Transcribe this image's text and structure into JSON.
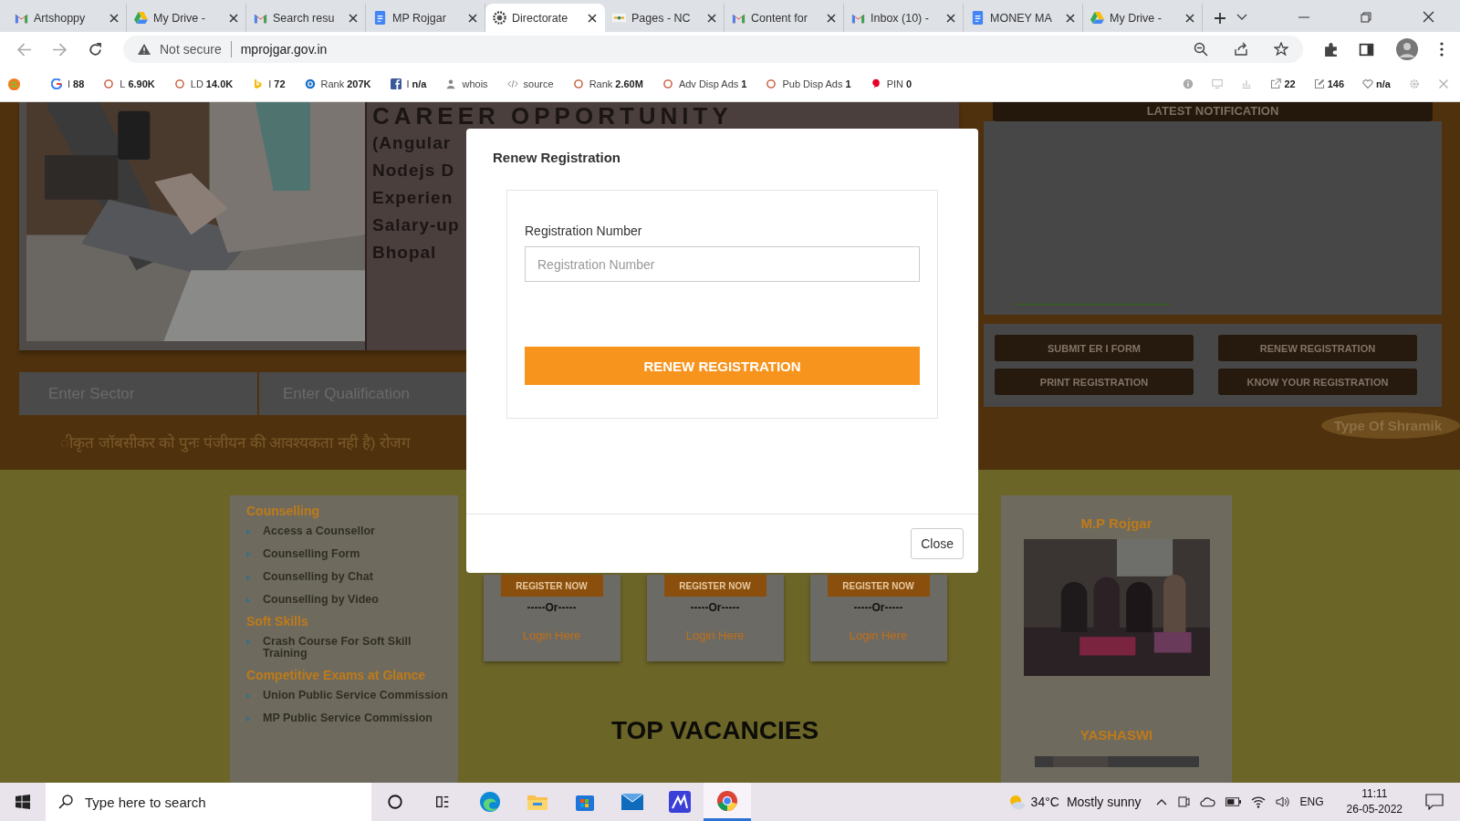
{
  "browser": {
    "tabs": [
      {
        "title": "Artshoppy",
        "selected": false
      },
      {
        "title": "My Drive -",
        "selected": false
      },
      {
        "title": "Search resu",
        "selected": false
      },
      {
        "title": "MP Rojgar",
        "selected": false
      },
      {
        "title": "Directorate",
        "selected": true
      },
      {
        "title": "Pages - NC",
        "selected": false
      },
      {
        "title": "Content for",
        "selected": false
      },
      {
        "title": "Inbox (10) -",
        "selected": false
      },
      {
        "title": "MONEY MA",
        "selected": false
      },
      {
        "title": "My Drive -",
        "selected": false
      }
    ],
    "security": "Not secure",
    "url": "mprojgar.gov.in",
    "seo_bar": [
      {
        "label": "I",
        "value": "88"
      },
      {
        "label": "L",
        "value": "6.90K"
      },
      {
        "label": "LD",
        "value": "14.0K"
      },
      {
        "label": "I",
        "value": "72"
      },
      {
        "label": "Rank",
        "value": "207K"
      },
      {
        "label": "I",
        "value": "n/a"
      },
      {
        "label": "whois"
      },
      {
        "label": "source"
      },
      {
        "label": "Rank",
        "value": "2.60M"
      },
      {
        "label": "Adv Disp Ads",
        "value": "1"
      },
      {
        "label": "Pub Disp Ads",
        "value": "1"
      },
      {
        "label": "PIN",
        "value": "0"
      }
    ],
    "seo_right": [
      {
        "value": "22"
      },
      {
        "value": "146"
      },
      {
        "value": "n/a"
      }
    ]
  },
  "page": {
    "banner": {
      "headline": "CAREER OPPORTUNITY",
      "lines": [
        "(Angular",
        "Nodejs D",
        "Experien",
        "Salary-up",
        "Bhopal"
      ]
    },
    "search": [
      {
        "placeholder": "Enter Sector"
      },
      {
        "placeholder": "Enter Qualification"
      }
    ],
    "marquee": "ीकृत जॉबसीकर को पुनः पंजीयन की आवश्यकता नही है)  रोजग",
    "notification_title": "LATEST NOTIFICATION",
    "actions": [
      "SUBMIT ER I FORM",
      "RENEW REGISTRATION",
      "PRINT REGISTRATION",
      "KNOW YOUR REGISTRATION"
    ],
    "floating_label": "Type Of Shramik",
    "sidebar": [
      {
        "heading": "Counselling",
        "items": [
          "Access a Counsellor",
          "Counselling Form",
          "Counselling by Chat",
          "Counselling by Video"
        ]
      },
      {
        "heading": "Soft Skills",
        "items": [
          "Crash Course For Soft Skill Training"
        ]
      },
      {
        "heading": "Competitive Exams at Glance",
        "items": [
          "Union Public Service Commission",
          "MP Public Service Commission"
        ]
      }
    ],
    "cards": [
      {
        "button": "REGISTER NOW",
        "separator": "-----Or-----",
        "link": "Login Here"
      },
      {
        "button": "REGISTER NOW",
        "separator": "-----Or-----",
        "link": "Login Here"
      },
      {
        "button": "REGISTER NOW",
        "separator": "-----Or-----",
        "link": "Login Here"
      }
    ],
    "section_title": "TOP VACANCIES",
    "right_card": {
      "title": "M.P Rojgar",
      "subtitle": "YASHASWI"
    }
  },
  "modal": {
    "title": "Renew Registration",
    "field_label": "Registration Number",
    "placeholder": "Registration Number",
    "submit": "RENEW REGISTRATION",
    "close": "Close"
  },
  "taskbar": {
    "search_placeholder": "Type here to search",
    "apps": [
      {
        "selected": false
      },
      {
        "selected": false
      },
      {
        "selected": false
      },
      {
        "selected": false
      },
      {
        "selected": false
      },
      {
        "selected": false
      },
      {
        "selected": false
      },
      {
        "selected": true
      }
    ],
    "temperature": "34°C",
    "weather": "Mostly sunny",
    "language": "ENG",
    "time": "11:11",
    "date": "26-05-2022"
  }
}
